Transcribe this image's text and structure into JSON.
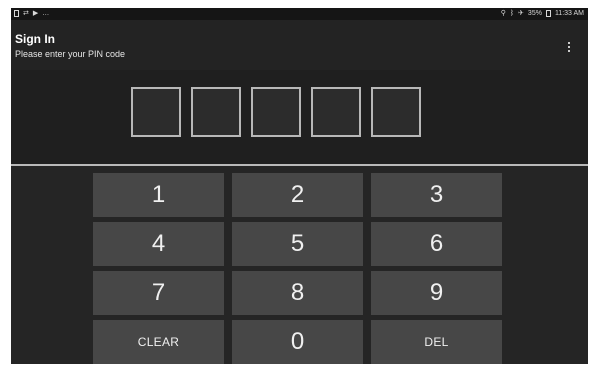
{
  "status_bar": {
    "left_icons": [
      "sim-card-icon",
      "usb-icon",
      "play-store-icon",
      "more-notifications-icon"
    ],
    "right_icons": [
      "location-icon",
      "bluetooth-icon",
      "airplane-mode-icon"
    ],
    "battery_text": "35%",
    "time": "11:33 AM"
  },
  "app_bar": {
    "title": "Sign In",
    "subtitle": "Please enter your PIN code",
    "overflow_icon": "more-vertical-icon"
  },
  "pin": {
    "box_count": 5,
    "entered_digits": 0
  },
  "keypad": {
    "keys": [
      "1",
      "2",
      "3",
      "4",
      "5",
      "6",
      "7",
      "8",
      "9",
      "CLEAR",
      "0",
      "DEL"
    ]
  },
  "colors": {
    "status_bar_bg": "#151515",
    "app_bar_bg": "#232323",
    "pin_area_bg": "#1f1f1f",
    "keypad_bg": "#252525",
    "key_bg": "#474747",
    "pin_box_border": "#b8b8b8"
  }
}
